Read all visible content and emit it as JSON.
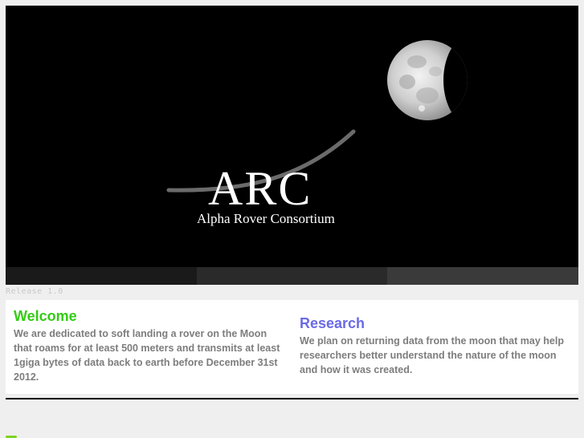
{
  "hero": {
    "logo_text": "ARC",
    "logo_subtitle": "Alpha Rover Consortium"
  },
  "navbar": {
    "colors": [
      "#1a1a1a",
      "#2a2a2a",
      "#3a3a3a"
    ]
  },
  "release_label": "Release 1.0",
  "sections": {
    "welcome": {
      "title": "Welcome",
      "body": "We are dedicated to soft landing a rover on the Moon that roams for at least 500 meters and transmits at least 1giga bytes of data back to earth before December 31st 2012.",
      "color": "#33cc14"
    },
    "research": {
      "title": "Research",
      "body": "We plan on returning data from the moon that may help researchers better understand the nature of the moon and how it was created.",
      "color": "#6a6ae6"
    }
  }
}
